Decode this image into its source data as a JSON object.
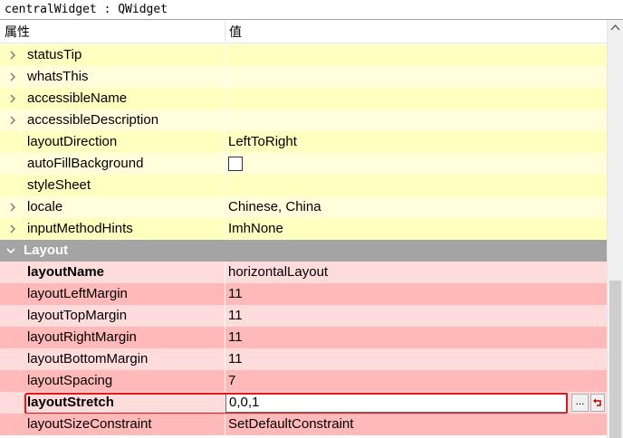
{
  "title": "centralWidget : QWidget",
  "header": {
    "property": "属性",
    "value": "值"
  },
  "rows": [
    {
      "name": "statusTip",
      "value": "",
      "expand": true
    },
    {
      "name": "whatsThis",
      "value": "",
      "expand": true
    },
    {
      "name": "accessibleName",
      "value": "",
      "expand": true
    },
    {
      "name": "accessibleDescription",
      "value": "",
      "expand": true
    },
    {
      "name": "layoutDirection",
      "value": "LeftToRight"
    },
    {
      "name": "autoFillBackground",
      "value": "",
      "checkbox": false
    },
    {
      "name": "styleSheet",
      "value": ""
    },
    {
      "name": "locale",
      "value": "Chinese, China",
      "expand": true
    },
    {
      "name": "inputMethodHints",
      "value": "ImhNone",
      "expand": true
    },
    {
      "name": "Layout",
      "section": true
    },
    {
      "name": "layoutName",
      "value": "horizontalLayout",
      "bold": true
    },
    {
      "name": "layoutLeftMargin",
      "value": "11"
    },
    {
      "name": "layoutTopMargin",
      "value": "11"
    },
    {
      "name": "layoutRightMargin",
      "value": "11"
    },
    {
      "name": "layoutBottomMargin",
      "value": "11"
    },
    {
      "name": "layoutSpacing",
      "value": "7"
    },
    {
      "name": "layoutStretch",
      "value": "0,0,1",
      "bold": true,
      "editing": true
    },
    {
      "name": "layoutSizeConstraint",
      "value": "SetDefaultConstraint"
    }
  ],
  "edit_buttons": {
    "browse": "..."
  },
  "colors": {
    "yellow_dark": "#ffffc0",
    "yellow_light": "#ffffdc",
    "pink_dark": "#ffb9b9",
    "pink_light": "#ffdcdc",
    "section_gray": "#a4a4a4",
    "highlight_red": "#e8141c"
  }
}
